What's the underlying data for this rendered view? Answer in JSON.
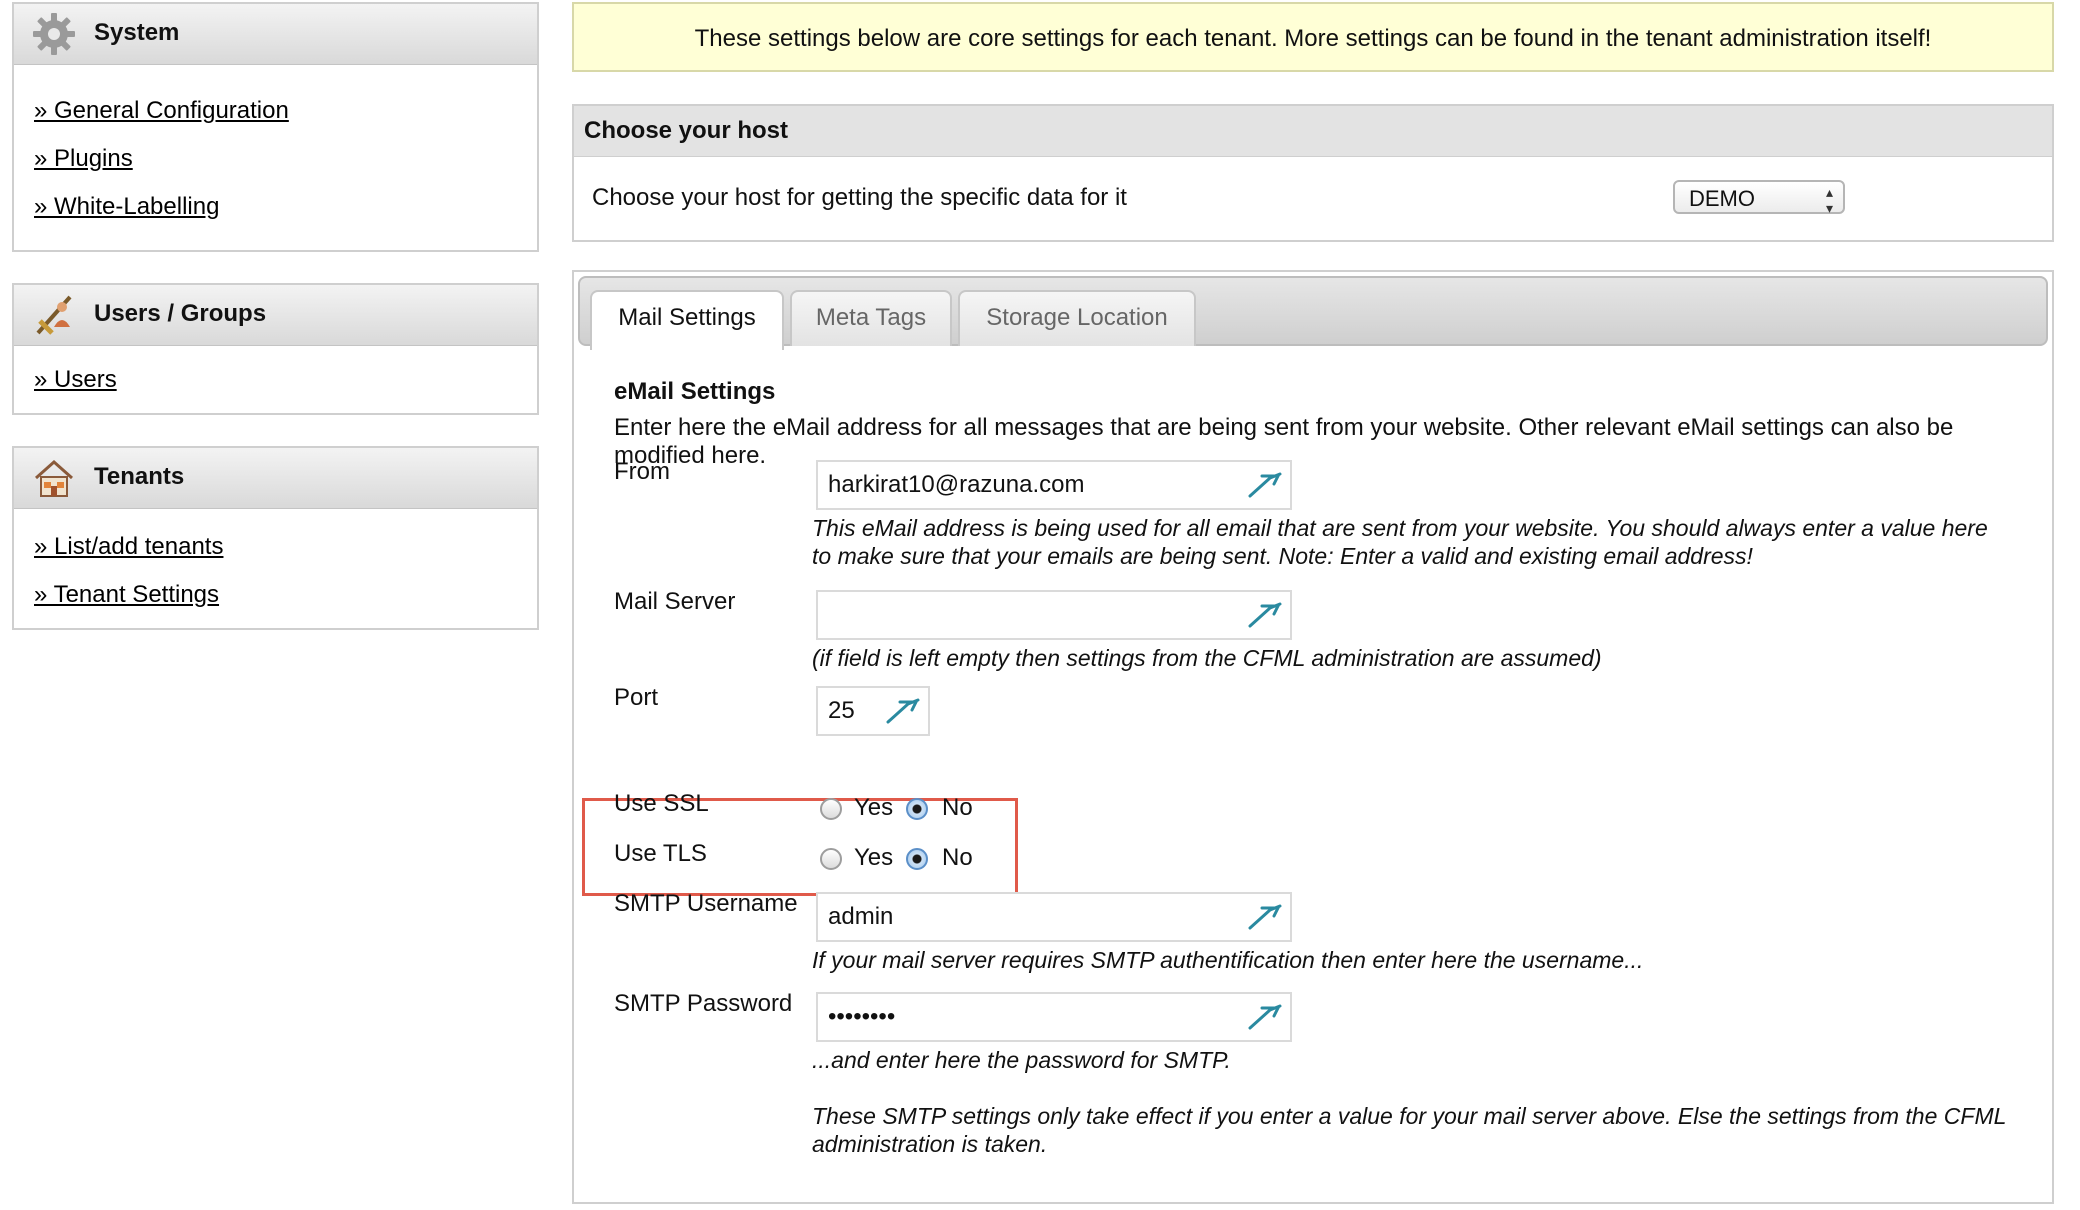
{
  "sidebar": {
    "system": {
      "title": "System",
      "links": [
        "» General Configuration",
        "» Plugins",
        "» White-Labelling"
      ]
    },
    "users": {
      "title": "Users / Groups",
      "links": [
        "» Users"
      ]
    },
    "tenants": {
      "title": "Tenants",
      "links": [
        "» List/add tenants",
        "» Tenant Settings"
      ]
    }
  },
  "notice": "These settings below are core settings for each tenant. More settings can be found in the tenant administration itself!",
  "host": {
    "title": "Choose your host",
    "description": "Choose your host for getting the specific data for it",
    "selected": "DEMO"
  },
  "tabs": [
    {
      "label": "Mail Settings",
      "active": true
    },
    {
      "label": "Meta Tags",
      "active": false
    },
    {
      "label": "Storage Location",
      "active": false
    }
  ],
  "mail": {
    "title": "eMail Settings",
    "description": "Enter here the eMail address for all messages that are being sent from your website. Other relevant eMail settings can also be modified here.",
    "from": {
      "label": "From",
      "value": "harkirat10@razuna.com",
      "hint": "This eMail address is being used for all email that are sent from your website. You should always enter a value here to make sure that your emails are being sent. Note: Enter a valid and existing email address!"
    },
    "server": {
      "label": "Mail Server",
      "value": "",
      "hint": "(if field is left empty then settings from the CFML administration are assumed)"
    },
    "port": {
      "label": "Port",
      "value": "25"
    },
    "ssl": {
      "label": "Use SSL",
      "yes": "Yes",
      "no": "No",
      "selected": "No"
    },
    "tls": {
      "label": "Use TLS",
      "yes": "Yes",
      "no": "No",
      "selected": "No"
    },
    "username": {
      "label": "SMTP Username",
      "value": "admin",
      "hint": "If your mail server requires SMTP authentification then enter here the username..."
    },
    "password": {
      "label": "SMTP Password",
      "value": "••••••••",
      "hint": "...and enter here the password for SMTP."
    },
    "footer": "These SMTP settings only take effect if you enter a value for your mail server above. Else the settings from the CFML administration is taken."
  },
  "colors": {
    "highlight": "#e05a4a",
    "notice_bg": "#ffffd6",
    "radio_on": "#5b8fc8",
    "pen": "#2a8aa0"
  }
}
